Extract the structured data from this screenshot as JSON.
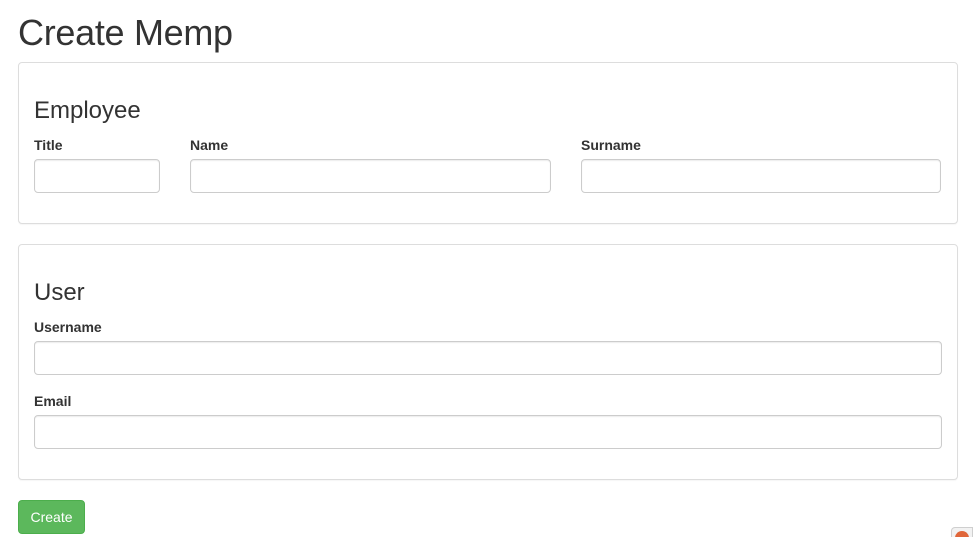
{
  "page": {
    "title": "Create Memp"
  },
  "employee_section": {
    "title": "Employee",
    "fields": {
      "title": {
        "label": "Title",
        "value": ""
      },
      "name": {
        "label": "Name",
        "value": ""
      },
      "surname": {
        "label": "Surname",
        "value": ""
      }
    }
  },
  "user_section": {
    "title": "User",
    "fields": {
      "username": {
        "label": "Username",
        "value": ""
      },
      "email": {
        "label": "Email",
        "value": ""
      }
    }
  },
  "actions": {
    "create_label": "Create"
  },
  "colors": {
    "primary_button": "#5cb85c",
    "panel_border": "#dddddd",
    "input_border": "#cccccc",
    "text": "#333333"
  },
  "icons": {
    "corner_widget": "feedback-widget-icon"
  }
}
